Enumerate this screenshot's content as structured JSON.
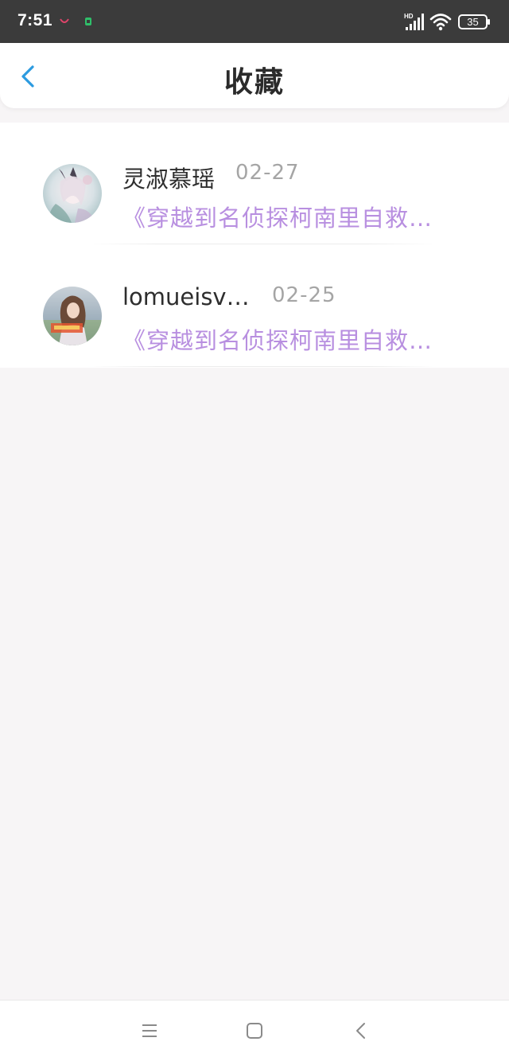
{
  "status_bar": {
    "time": "7:51",
    "network": "HD",
    "battery": "35"
  },
  "header": {
    "title": "收藏"
  },
  "items": [
    {
      "user": "灵淑慕瑶",
      "date": "02-27",
      "link": "《穿越到名侦探柯南里自救…"
    },
    {
      "user": "lomueisv…",
      "date": "02-25",
      "link": "《穿越到名侦探柯南里自救…"
    }
  ],
  "colors": {
    "accent": "#2c9be0",
    "link": "#b88fe0",
    "status_bar": "#3b3b3b",
    "page_bg": "#f7f5f6"
  },
  "icons": {
    "back": "chevron-left-icon",
    "menu": "menu-icon",
    "home": "square-icon",
    "nav_back": "chevron-left-icon"
  }
}
